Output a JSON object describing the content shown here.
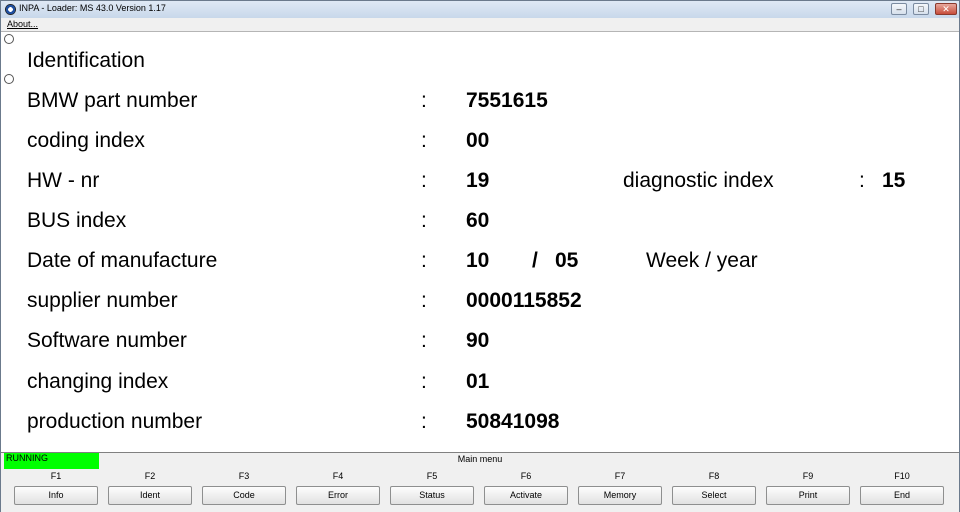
{
  "window": {
    "title": "INPA - Loader:  MS 43.0 Version 1.17",
    "menu_about": "About...",
    "min_icon": "–",
    "max_icon": "□",
    "close_icon": "✕"
  },
  "identification": {
    "heading": "Identification",
    "rows": [
      {
        "label": "BMW part number",
        "sep": ":",
        "value": "7551615"
      },
      {
        "label": "coding index",
        "sep": ":",
        "value": "00"
      },
      {
        "label": "HW - nr",
        "sep": ":",
        "value": "19",
        "extra_label": "diagnostic index",
        "extra_sep": ":",
        "extra_value": "15"
      },
      {
        "label": "BUS index",
        "sep": ":",
        "value": "60"
      },
      {
        "label": "Date of manufacture",
        "sep": ":",
        "value": "10",
        "slash": "/",
        "value2": "05",
        "extra_label": "Week / year"
      },
      {
        "label": "supplier number",
        "sep": ":",
        "value": "0000115852"
      },
      {
        "label": "Software number",
        "sep": ":",
        "value": "90"
      },
      {
        "label": "changing index",
        "sep": ":",
        "value": "01"
      },
      {
        "label": "production number",
        "sep": ":",
        "value": "50841098"
      }
    ]
  },
  "status": {
    "text": "RUNNING",
    "color": "#00ff00"
  },
  "menu": {
    "title": "Main menu",
    "keys": [
      {
        "key": "F1",
        "label": "Info"
      },
      {
        "key": "F2",
        "label": "Ident"
      },
      {
        "key": "F3",
        "label": "Code"
      },
      {
        "key": "F4",
        "label": "Error"
      },
      {
        "key": "F5",
        "label": "Status"
      },
      {
        "key": "F6",
        "label": "Activate"
      },
      {
        "key": "F7",
        "label": "Memory"
      },
      {
        "key": "F8",
        "label": "Select"
      },
      {
        "key": "F9",
        "label": "Print"
      },
      {
        "key": "F10",
        "label": "End"
      }
    ]
  }
}
